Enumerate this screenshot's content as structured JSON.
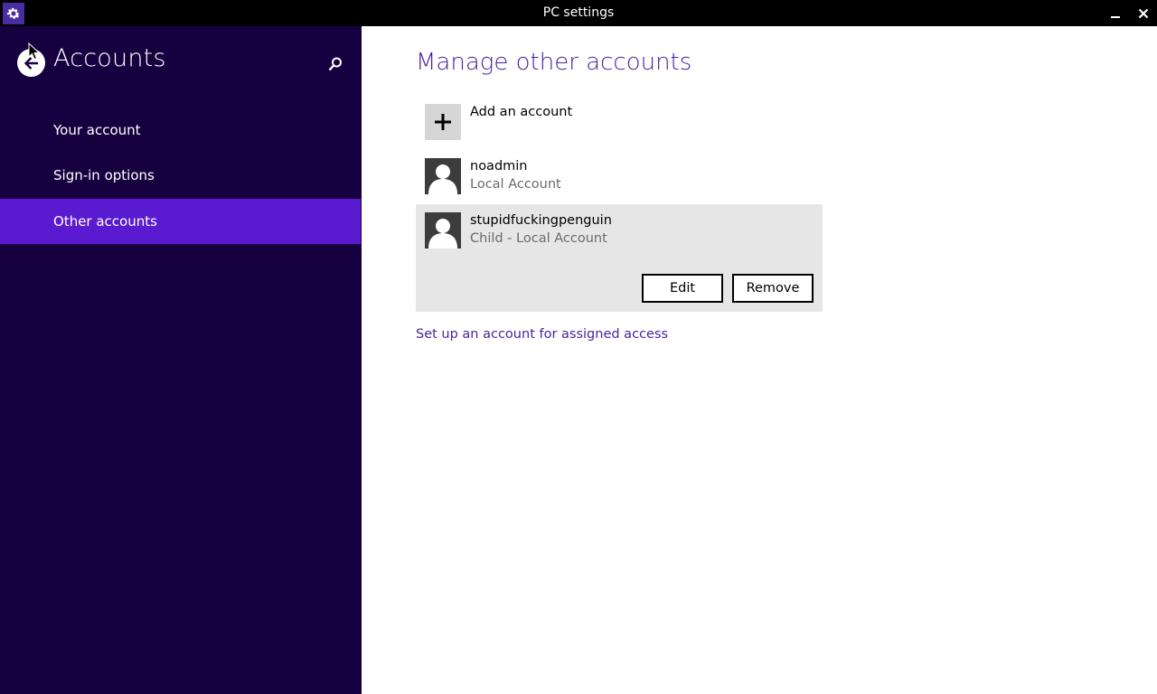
{
  "window": {
    "title": "PC settings",
    "minimize_glyph": "—",
    "close_glyph": "✕"
  },
  "sidebar": {
    "title": "Accounts",
    "items": [
      {
        "label": "Your account",
        "selected": false
      },
      {
        "label": "Sign-in options",
        "selected": false
      },
      {
        "label": "Other accounts",
        "selected": true
      }
    ]
  },
  "main": {
    "title": "Manage other accounts",
    "add_account": {
      "label": "Add an account"
    },
    "accounts": [
      {
        "name": "noadmin",
        "type": "Local Account"
      },
      {
        "name": "stupidfuckingpenguin",
        "type": "Child - Local Account"
      }
    ],
    "buttons": {
      "edit": "Edit",
      "remove": "Remove"
    },
    "assigned_access_link": "Set up an account for assigned access"
  },
  "colors": {
    "sidebar_bg": "#17003f",
    "selected_nav": "#5a1ad0",
    "accent_text": "#4b1f9e",
    "titlebar_bg": "#000000",
    "selected_panel": "#e6e6e6"
  },
  "icons": {
    "app": "gear-icon",
    "back": "back-arrow-icon",
    "search": "search-icon",
    "add": "plus-icon",
    "user": "user-avatar-icon"
  }
}
